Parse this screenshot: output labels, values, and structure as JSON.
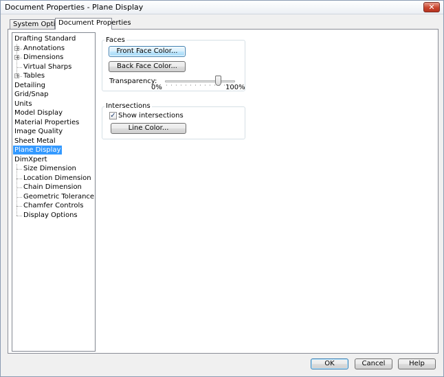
{
  "window": {
    "title": "Document Properties - Plane Display",
    "close_glyph": "✕"
  },
  "tabs": [
    {
      "label": "System Options",
      "active": false
    },
    {
      "label": "Document Properties",
      "active": true
    }
  ],
  "tree": {
    "items": [
      {
        "label": "Drafting Standard",
        "level": 0,
        "expander": false
      },
      {
        "label": "Annotations",
        "level": 1,
        "expander": true
      },
      {
        "label": "Dimensions",
        "level": 1,
        "expander": true
      },
      {
        "label": "Virtual Sharps",
        "level": 1,
        "expander": false
      },
      {
        "label": "Tables",
        "level": 1,
        "expander": true
      },
      {
        "label": "Detailing",
        "level": 0,
        "expander": false
      },
      {
        "label": "Grid/Snap",
        "level": 0,
        "expander": false
      },
      {
        "label": "Units",
        "level": 0,
        "expander": false
      },
      {
        "label": "Model Display",
        "level": 0,
        "expander": false
      },
      {
        "label": "Material Properties",
        "level": 0,
        "expander": false
      },
      {
        "label": "Image Quality",
        "level": 0,
        "expander": false
      },
      {
        "label": "Sheet Metal",
        "level": 0,
        "expander": false
      },
      {
        "label": "Plane Display",
        "level": 0,
        "expander": false,
        "selected": true
      },
      {
        "label": "DimXpert",
        "level": 0,
        "expander": false
      },
      {
        "label": "Size Dimension",
        "level": 1,
        "expander": false
      },
      {
        "label": "Location Dimension",
        "level": 1,
        "expander": false
      },
      {
        "label": "Chain Dimension",
        "level": 1,
        "expander": false
      },
      {
        "label": "Geometric Tolerance",
        "level": 1,
        "expander": false
      },
      {
        "label": "Chamfer Controls",
        "level": 1,
        "expander": false
      },
      {
        "label": "Display Options",
        "level": 1,
        "expander": false
      }
    ],
    "expander_glyph": "+"
  },
  "faces": {
    "group_label": "Faces",
    "front_face_button": "Front Face Color...",
    "back_face_button": "Back Face Color...",
    "transparency_label": "Transparency:",
    "transparency_min": "0%",
    "transparency_max": "100%",
    "transparency_value": 0.75
  },
  "intersections": {
    "group_label": "Intersections",
    "show_intersections_label": "Show intersections",
    "show_intersections_checked": true,
    "check_glyph": "✓",
    "line_color_button": "Line Color..."
  },
  "footer": {
    "ok": "OK",
    "cancel": "Cancel",
    "help": "Help"
  }
}
